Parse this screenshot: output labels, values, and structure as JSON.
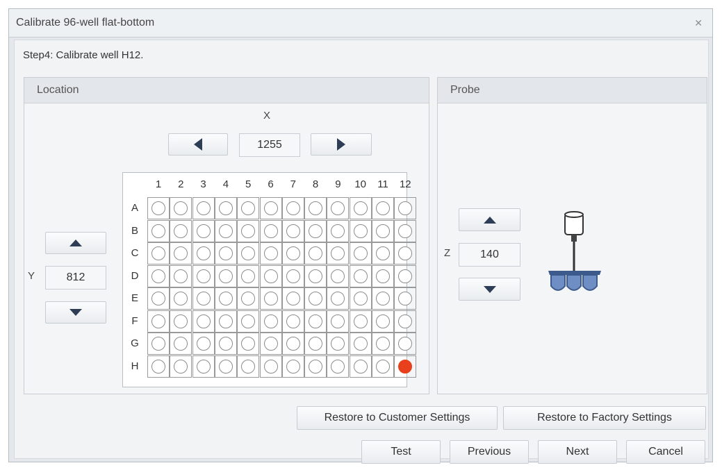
{
  "window": {
    "title": "Calibrate 96-well flat-bottom",
    "close_icon": "close-icon"
  },
  "step": "Step4: Calibrate well H12.",
  "location": {
    "heading": "Location",
    "x_label": "X",
    "x_value": "1255",
    "y_label": "Y",
    "y_value": "812",
    "plate": {
      "columns": [
        "1",
        "2",
        "3",
        "4",
        "5",
        "6",
        "7",
        "8",
        "9",
        "10",
        "11",
        "12"
      ],
      "rows": [
        "A",
        "B",
        "C",
        "D",
        "E",
        "F",
        "G",
        "H"
      ],
      "selected_well": "H12",
      "selected_color": "#e8401c"
    }
  },
  "probe": {
    "heading": "Probe",
    "z_label": "Z",
    "z_value": "140"
  },
  "buttons": {
    "restore_customer": "Restore to Customer Settings",
    "restore_factory": "Restore to Factory Settings",
    "test": "Test",
    "previous": "Previous",
    "next": "Next",
    "cancel": "Cancel"
  }
}
